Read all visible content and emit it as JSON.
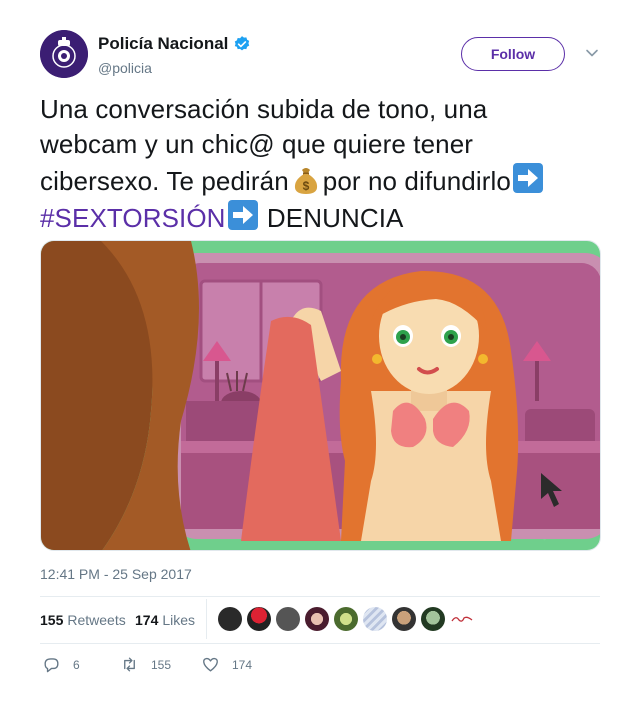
{
  "account": {
    "display_name": "Policía Nacional",
    "handle": "@policia",
    "verified": true,
    "avatar_icon": "police-badge-icon"
  },
  "follow_label": "Follow",
  "tweet": {
    "line1": "Una conversación subida de tono, una",
    "line2": "webcam y un chic@ que quiere tener",
    "line3a": "cibersexo. Te pedirán",
    "line3b": "por no difundirlo",
    "hashtag": "#SEXTORSIÓN",
    "denuncia": "DENUNCIA",
    "emoji_money": "money-bag-icon",
    "emoji_arrow": "right-arrow-icon"
  },
  "timestamp": "12:41 PM - 25 Sep 2017",
  "stats": {
    "retweets_count": "155",
    "retweets_label": "Retweets",
    "likes_count": "174",
    "likes_label": "Likes"
  },
  "actions": {
    "reply_count": "6",
    "retweet_count": "155",
    "like_count": "174"
  },
  "colors": {
    "accent": "#5b2fa8",
    "text": "#14171a",
    "muted": "#657786"
  }
}
